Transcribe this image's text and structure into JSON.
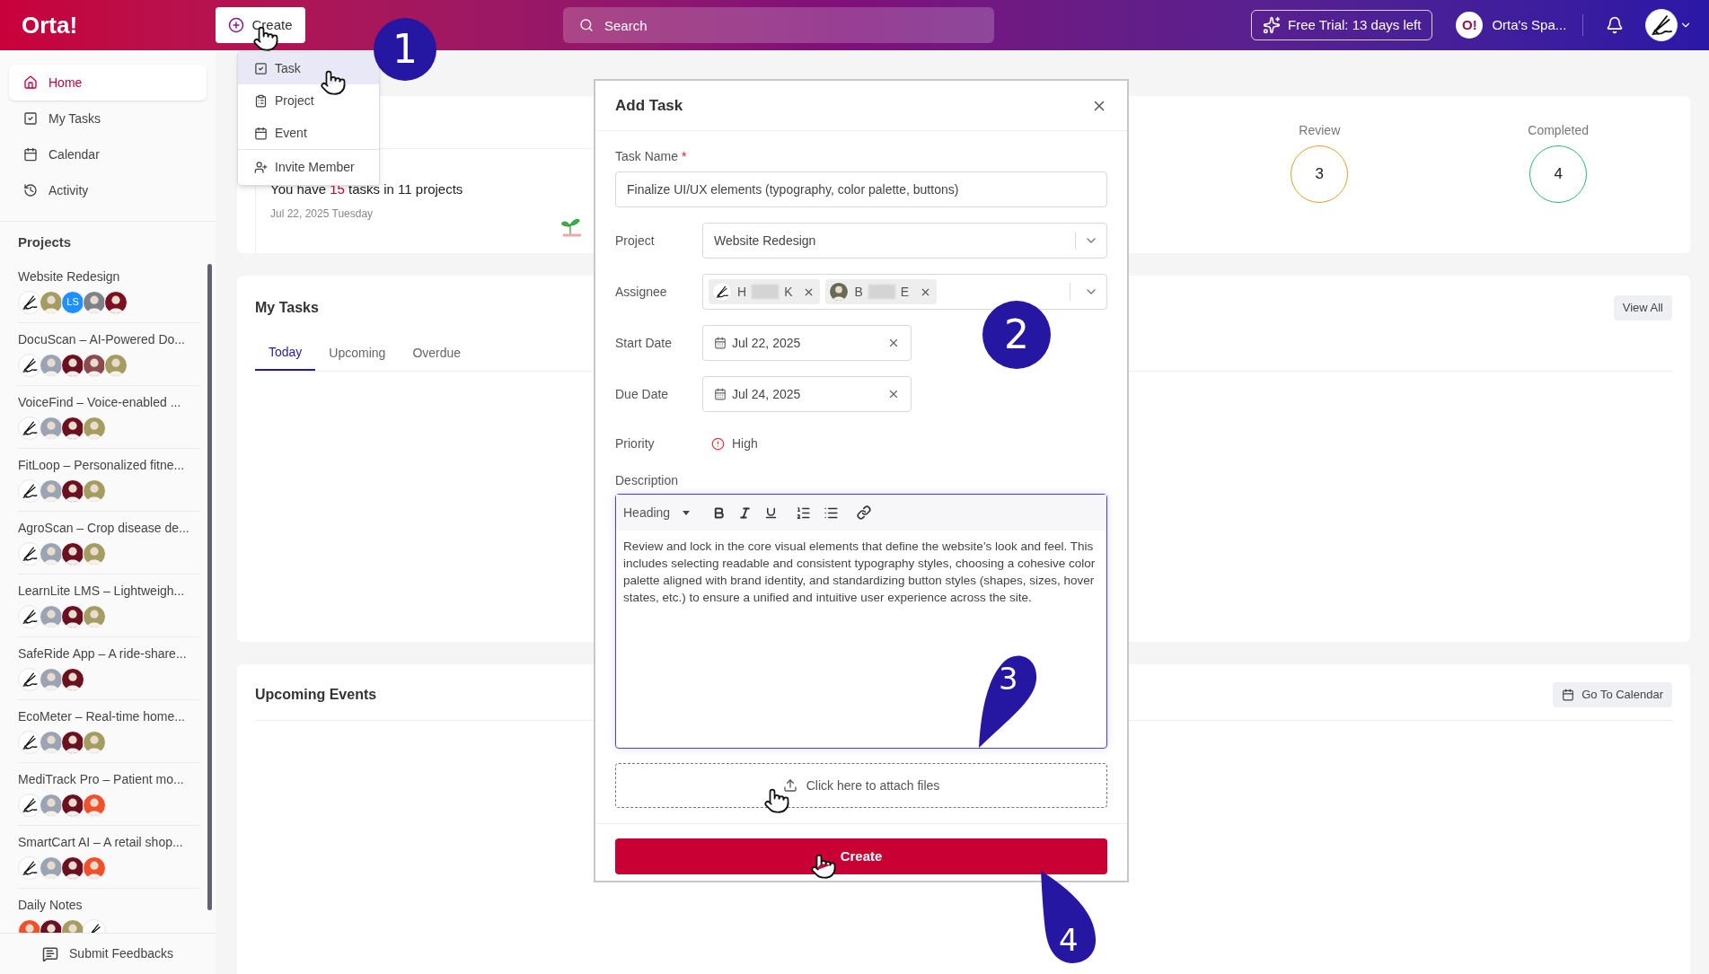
{
  "header": {
    "logo": "Orta!",
    "create_button": "Create",
    "search": {
      "placeholder": "Search"
    },
    "trial": "Free Trial: 13 days left",
    "workspace": {
      "badge": "O!",
      "name": "Orta's Spa..."
    }
  },
  "create_menu": [
    {
      "label": "Task",
      "kind": "task",
      "selected": true
    },
    {
      "label": "Project",
      "kind": "project",
      "selected": false
    },
    {
      "label": "Event",
      "kind": "event",
      "selected": false
    },
    {
      "label": "Invite Member",
      "kind": "invite",
      "selected": false
    }
  ],
  "sidebar": {
    "nav": [
      {
        "label": "Home",
        "kind": "home",
        "selected": true
      },
      {
        "label": "My Tasks",
        "kind": "tasks",
        "selected": false
      },
      {
        "label": "Calendar",
        "kind": "calendar",
        "selected": false
      },
      {
        "label": "Activity",
        "kind": "activity",
        "selected": false
      }
    ],
    "projects_heading": "Projects",
    "projects": [
      {
        "name": "Website Redesign",
        "avatars": [
          {
            "kind": "signature"
          },
          {
            "kind": "photo",
            "color": "#a59c62"
          },
          {
            "kind": "initials",
            "text": "LS",
            "color": "#1e90ff"
          },
          {
            "kind": "photo",
            "color": "#7d8288"
          },
          {
            "kind": "photo",
            "color": "#7a1022"
          }
        ]
      },
      {
        "name": "DocuScan – AI-Powered Do...",
        "avatars": [
          {
            "kind": "signature"
          },
          {
            "kind": "photo",
            "color": "#9aa4b3"
          },
          {
            "kind": "photo",
            "color": "#6b1020"
          },
          {
            "kind": "photo",
            "color": "#8a4a50"
          },
          {
            "kind": "photo",
            "color": "#a59c62"
          }
        ]
      },
      {
        "name": "VoiceFind – Voice-enabled ...",
        "avatars": [
          {
            "kind": "signature"
          },
          {
            "kind": "photo",
            "color": "#9aa4b3"
          },
          {
            "kind": "photo",
            "color": "#6b1020"
          },
          {
            "kind": "photo",
            "color": "#a59c62"
          }
        ]
      },
      {
        "name": "FitLoop – Personalized fitne...",
        "avatars": [
          {
            "kind": "signature"
          },
          {
            "kind": "photo",
            "color": "#9aa4b3"
          },
          {
            "kind": "photo",
            "color": "#6b1020"
          },
          {
            "kind": "photo",
            "color": "#a59c62"
          }
        ]
      },
      {
        "name": "AgroScan – Crop disease de...",
        "avatars": [
          {
            "kind": "signature"
          },
          {
            "kind": "photo",
            "color": "#9aa4b3"
          },
          {
            "kind": "photo",
            "color": "#6b1020"
          },
          {
            "kind": "photo",
            "color": "#a59c62"
          }
        ]
      },
      {
        "name": "LearnLite LMS – Lightweigh...",
        "avatars": [
          {
            "kind": "signature"
          },
          {
            "kind": "photo",
            "color": "#9aa4b3"
          },
          {
            "kind": "photo",
            "color": "#6b1020"
          },
          {
            "kind": "photo",
            "color": "#a59c62"
          }
        ]
      },
      {
        "name": "SafeRide App – A ride-share...",
        "avatars": [
          {
            "kind": "signature"
          },
          {
            "kind": "photo",
            "color": "#9aa4b3"
          },
          {
            "kind": "photo",
            "color": "#6b1020"
          }
        ]
      },
      {
        "name": "EcoMeter – Real-time home...",
        "avatars": [
          {
            "kind": "signature"
          },
          {
            "kind": "photo",
            "color": "#9aa4b3"
          },
          {
            "kind": "photo",
            "color": "#6b1020"
          },
          {
            "kind": "photo",
            "color": "#a59c62"
          }
        ]
      },
      {
        "name": "MediTrack Pro – Patient mo...",
        "avatars": [
          {
            "kind": "signature"
          },
          {
            "kind": "photo",
            "color": "#9aa4b3"
          },
          {
            "kind": "photo",
            "color": "#6b1020"
          },
          {
            "kind": "photo",
            "color": "#f0502a"
          }
        ]
      },
      {
        "name": "SmartCart AI – A retail shop...",
        "avatars": [
          {
            "kind": "signature"
          },
          {
            "kind": "photo",
            "color": "#9aa4b3"
          },
          {
            "kind": "photo",
            "color": "#6b1020"
          },
          {
            "kind": "photo",
            "color": "#f0502a"
          }
        ]
      },
      {
        "name": "Daily Notes",
        "avatars": [
          {
            "kind": "photo",
            "color": "#f0502a"
          },
          {
            "kind": "photo",
            "color": "#6b1020"
          },
          {
            "kind": "photo",
            "color": "#a59c62"
          },
          {
            "kind": "signature"
          }
        ]
      }
    ],
    "feedback": "Submit Feedbacks"
  },
  "summary": {
    "before": "You have",
    "count": "15",
    "after": "tasks in 11 projects",
    "date": "Jul 22, 2025 Tuesday",
    "stats": [
      {
        "label": "Review",
        "value": "3",
        "color": "#e0a030"
      },
      {
        "label": "Completed",
        "value": "4",
        "color": "#2eb86a"
      }
    ]
  },
  "my_tasks": {
    "title": "My Tasks",
    "view_all": "View All",
    "tabs": [
      {
        "label": "Today",
        "selected": true
      },
      {
        "label": "Upcoming",
        "selected": false
      },
      {
        "label": "Overdue",
        "selected": false
      }
    ]
  },
  "events": {
    "title": "Upcoming Events",
    "button": "Go To Calendar"
  },
  "modal": {
    "title": "Add Task",
    "task_name_label": "Task Name",
    "required_mark": "*",
    "task_name": "Finalize UI/UX elements (typography, color palette, buttons)",
    "project_label": "Project",
    "project": "Website Redesign",
    "assignee_label": "Assignee",
    "assignees": [
      {
        "kind": "signature",
        "first": "H",
        "last": "K"
      },
      {
        "kind": "photo",
        "color": "#6a6a58",
        "first": "B",
        "last": "E"
      }
    ],
    "start_label": "Start Date",
    "start": "Jul 22, 2025",
    "due_label": "Due Date",
    "due": "Jul 24, 2025",
    "priority_label": "Priority",
    "priority": "High",
    "description_label": "Description",
    "heading_select": "Heading",
    "description": "Review and lock in the core visual elements that define the website’s look and feel. This includes selecting readable and consistent typography styles, choosing a cohesive color palette aligned with brand identity, and standardizing button styles (shapes, sizes, hover states, etc.) to ensure a unified and intuitive user experience across the site.",
    "attach": "Click here to attach files",
    "submit": "Create"
  },
  "markers": [
    {
      "number": "1",
      "kind": "circle"
    },
    {
      "number": "2",
      "kind": "circle"
    },
    {
      "number": "3",
      "kind": "drop-down"
    },
    {
      "number": "4",
      "kind": "drop-up"
    }
  ]
}
